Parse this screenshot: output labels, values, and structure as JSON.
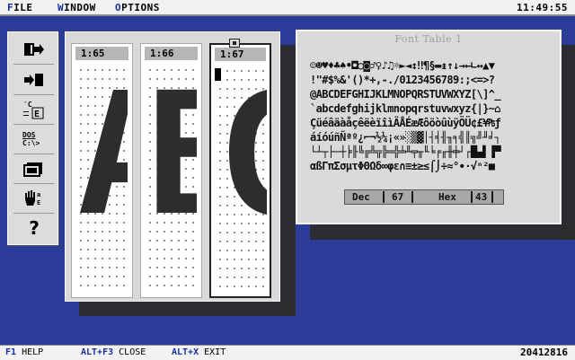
{
  "menubar": {
    "items": [
      {
        "hot": "F",
        "rest": "ILE"
      },
      {
        "hot": "W",
        "rest": "INDOW"
      },
      {
        "hot": "O",
        "rest": "PTIONS"
      }
    ],
    "clock": "11:49:55"
  },
  "toolbar": {
    "tools": [
      "file-open-icon",
      "file-save-icon",
      "character-map-icon",
      "dos-shell-icon",
      "window-icon",
      "hand-ascii-icon",
      "help-icon"
    ],
    "dos_label": "DOS",
    "dos_prompt": "C:\\>",
    "help_label": "?"
  },
  "editor": {
    "columns": [
      {
        "label": "1:65",
        "glyph": "A"
      },
      {
        "label": "1:66",
        "glyph": "B"
      },
      {
        "label": "1:67",
        "glyph": "C"
      }
    ]
  },
  "font_table": {
    "title": "Font Table 1",
    "rows": [
      " ☺☻♥♦♣♠•◘○◙♂♀♪♫☼►◄↕‼¶§▬↨↑↓→←∟↔▲▼",
      " !\"#$%&'()*+,-./0123456789:;<=>?",
      "@ABCDEFGHIJKLMNOPQRSTUVWXYZ[\\]^_",
      "`abcdefghijklmnopqrstuvwxyz{|}~⌂",
      "ÇüéâäàåçêëèïîìÄÅÉæÆôöòûùÿÖÜ¢£¥₧ƒ",
      "áíóúñÑªº¿⌐¬½¼¡«»░▒▓│┤╡╢╖╕╣║╗╝╜╛┐",
      "└┴┬├─┼╞╟╚╔╩╦╠═╬╧╨╤╥╙╘╒╓╫╪┘┌█▄▌▐▀",
      "αßΓπΣσµτΦΘΩδ∞φε∩≡±≥≤⌠⌡÷≈°∙·√ⁿ²■ "
    ],
    "dec_label": "Dec",
    "dec_value": "67",
    "hex_label": "Hex",
    "hex_value": "43"
  },
  "statusbar": {
    "items": [
      {
        "key": "F1",
        "label": "HELP"
      },
      {
        "key": "ALT+F3",
        "label": "CLOSE"
      },
      {
        "key": "ALT+X",
        "label": "EXIT"
      }
    ],
    "code": "20412816"
  }
}
